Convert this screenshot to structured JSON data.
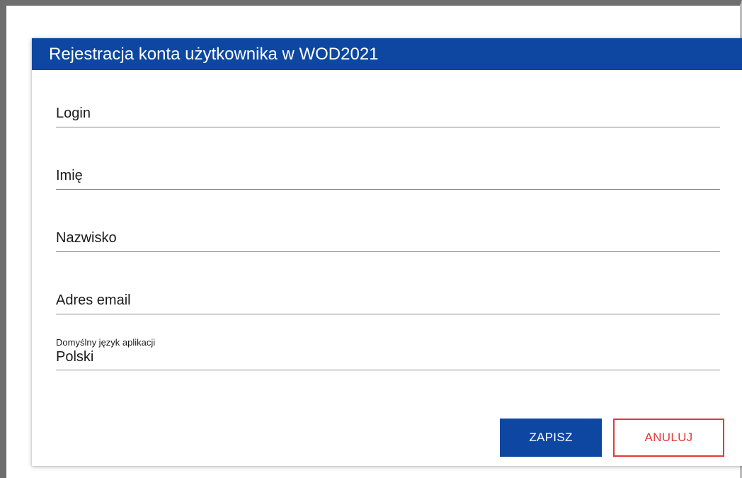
{
  "dialog": {
    "title": "Rejestracja konta użytkownika w WOD2021"
  },
  "form": {
    "login_label": "Login",
    "first_name_label": "Imię",
    "last_name_label": "Nazwisko",
    "email_label": "Adres email",
    "language": {
      "label": "Domyślny język aplikacji",
      "value": "Polski"
    }
  },
  "buttons": {
    "save_label": "ZAPISZ",
    "cancel_label": "ANULUJ"
  },
  "colors": {
    "primary": "#0d47a1",
    "danger": "#e53935"
  }
}
